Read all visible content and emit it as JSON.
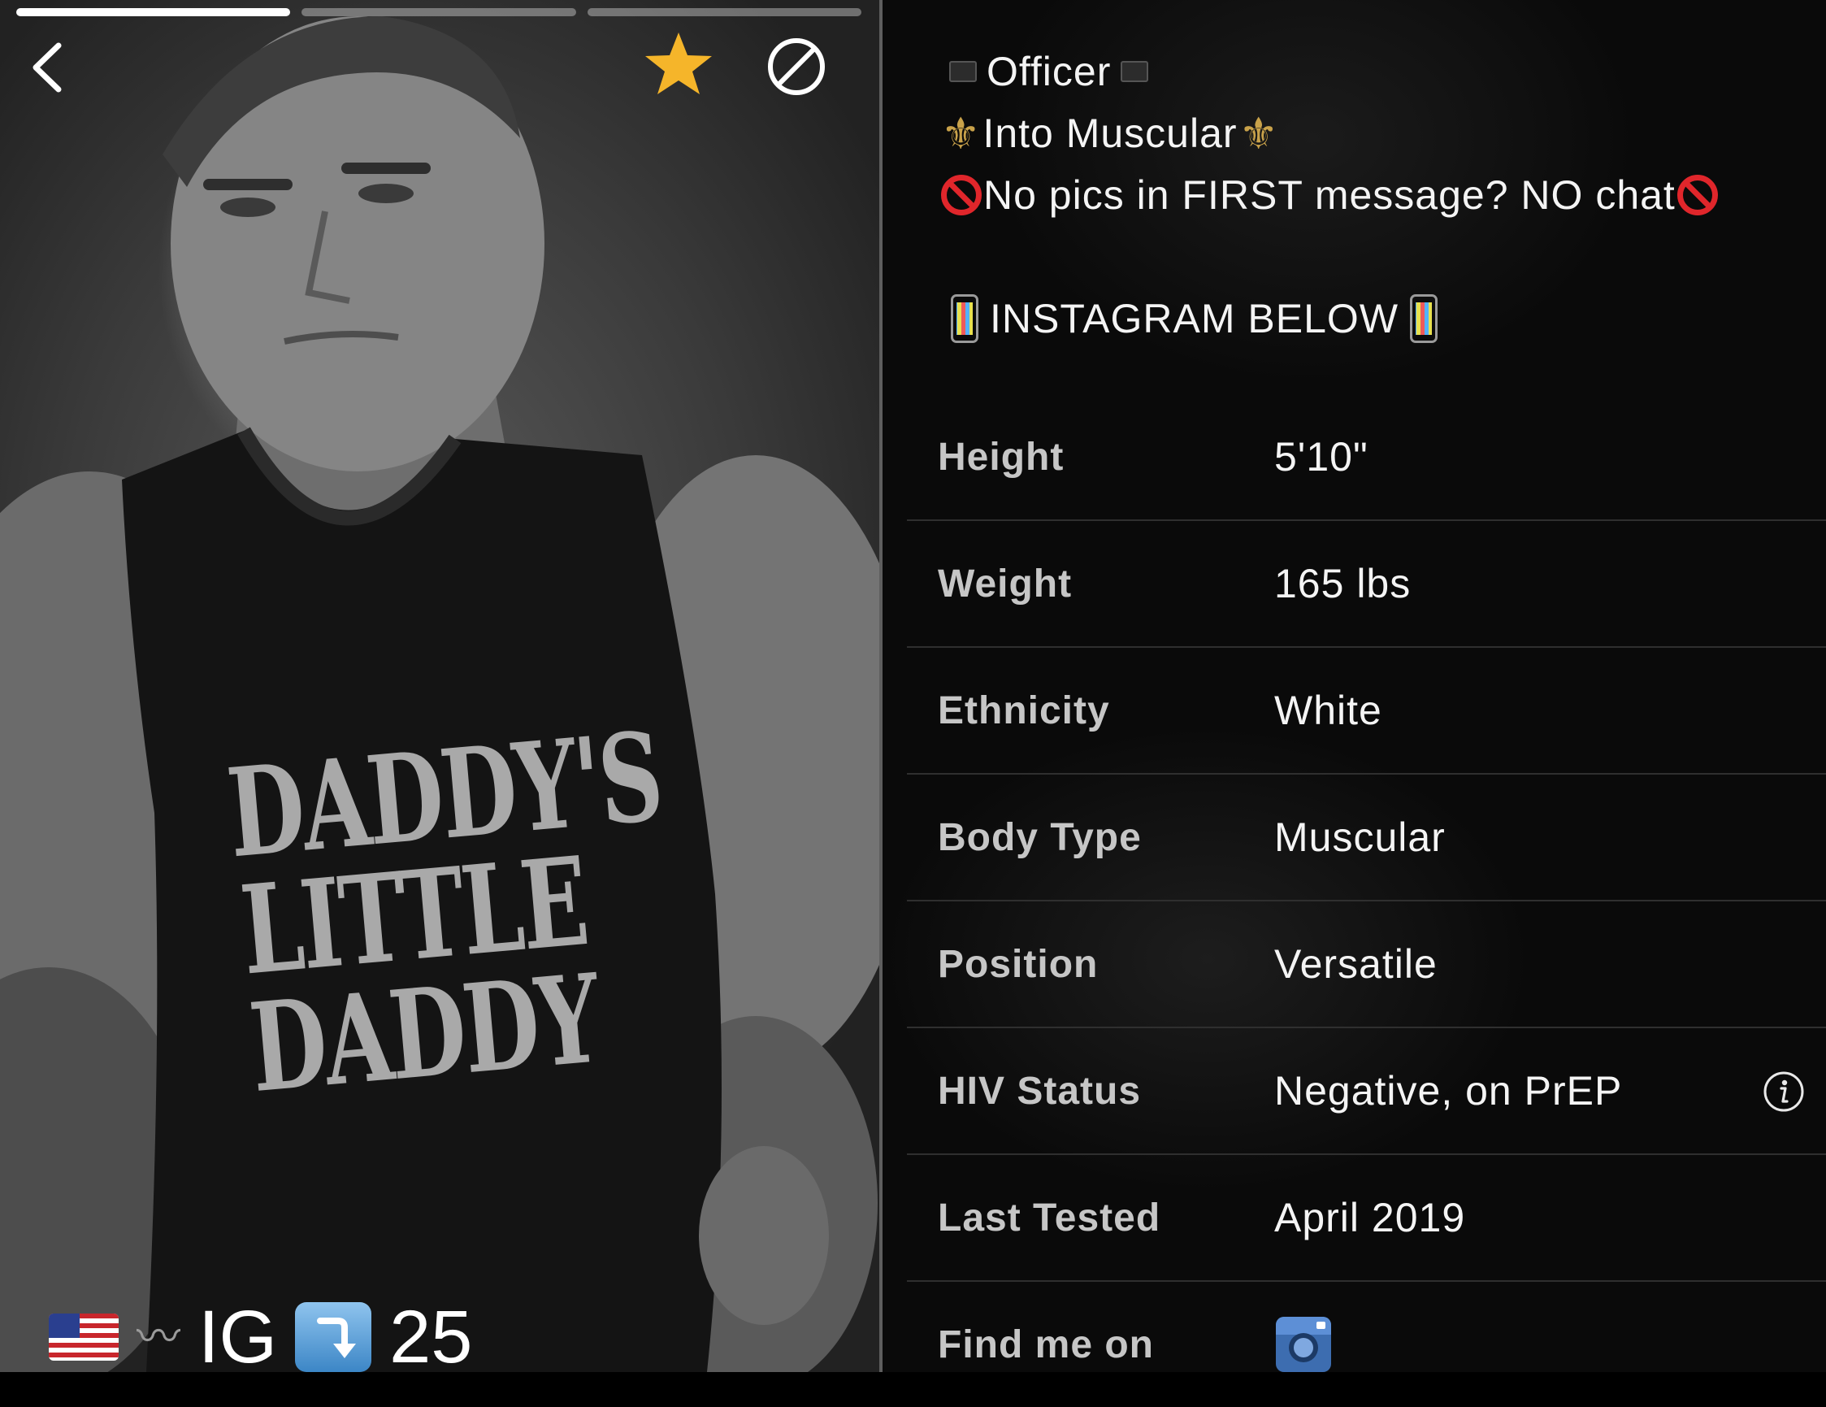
{
  "photo": {
    "progress_segments": 3,
    "active_segment": 1,
    "shirt_text": [
      "DADDY'S",
      "LITTLE",
      "DADDY"
    ],
    "bottom": {
      "flag": "us-flag-icon",
      "ig_label": "IG",
      "age": "25"
    }
  },
  "icons": {
    "back": "back-chevron-icon",
    "favorite": "star-icon",
    "block": "block-icon",
    "info": "info-icon",
    "instagram": "instagram-icon"
  },
  "colors": {
    "star": "#F5B52A",
    "accent_blue": "#3C86C6",
    "label_gray": "#C6C6C6"
  },
  "bio": {
    "line1": "Officer",
    "line2": "Into Muscular",
    "line3": "No pics in FIRST message? NO chat",
    "line4": "INSTAGRAM BELOW"
  },
  "stats": [
    {
      "label": "Height",
      "value": "5'10\""
    },
    {
      "label": "Weight",
      "value": "165 lbs"
    },
    {
      "label": "Ethnicity",
      "value": "White"
    },
    {
      "label": "Body Type",
      "value": "Muscular"
    },
    {
      "label": "Position",
      "value": "Versatile"
    },
    {
      "label": "HIV Status",
      "value": "Negative, on PrEP"
    },
    {
      "label": "Last Tested",
      "value": "April 2019"
    },
    {
      "label": "Find me on",
      "value": ""
    }
  ]
}
